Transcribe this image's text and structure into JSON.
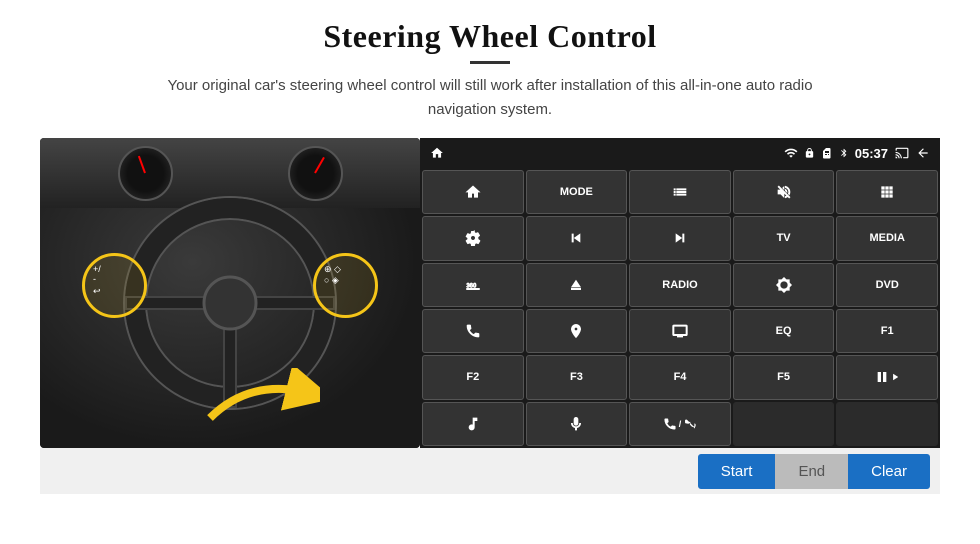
{
  "header": {
    "title": "Steering Wheel Control",
    "subtitle": "Your original car's steering wheel control will still work after installation of this all-in-one auto radio navigation system."
  },
  "statusBar": {
    "time": "05:37",
    "icons": [
      "wifi",
      "lock",
      "sim",
      "bluetooth",
      "screen",
      "back"
    ]
  },
  "controlButtons": [
    {
      "id": "row1",
      "buttons": [
        {
          "label": "",
          "icon": "home"
        },
        {
          "label": "MODE",
          "icon": ""
        },
        {
          "label": "",
          "icon": "list"
        },
        {
          "label": "",
          "icon": "mute"
        },
        {
          "label": "",
          "icon": "apps"
        }
      ]
    },
    {
      "id": "row2",
      "buttons": [
        {
          "label": "",
          "icon": "settings"
        },
        {
          "label": "",
          "icon": "rewind"
        },
        {
          "label": "",
          "icon": "forward"
        },
        {
          "label": "TV",
          "icon": ""
        },
        {
          "label": "MEDIA",
          "icon": ""
        }
      ]
    },
    {
      "id": "row3",
      "buttons": [
        {
          "label": "",
          "icon": "360"
        },
        {
          "label": "",
          "icon": "eject"
        },
        {
          "label": "RADIO",
          "icon": ""
        },
        {
          "label": "",
          "icon": "brightness"
        },
        {
          "label": "DVD",
          "icon": ""
        }
      ]
    },
    {
      "id": "row4",
      "buttons": [
        {
          "label": "",
          "icon": "phone"
        },
        {
          "label": "",
          "icon": "gps"
        },
        {
          "label": "",
          "icon": "screen2"
        },
        {
          "label": "EQ",
          "icon": ""
        },
        {
          "label": "F1",
          "icon": ""
        }
      ]
    },
    {
      "id": "row5",
      "buttons": [
        {
          "label": "F2",
          "icon": ""
        },
        {
          "label": "F3",
          "icon": ""
        },
        {
          "label": "F4",
          "icon": ""
        },
        {
          "label": "F5",
          "icon": ""
        },
        {
          "label": "",
          "icon": "playpause"
        }
      ]
    },
    {
      "id": "row6",
      "buttons": [
        {
          "label": "",
          "icon": "music"
        },
        {
          "label": "",
          "icon": "mic"
        },
        {
          "label": "",
          "icon": "voicecall"
        },
        {
          "label": "",
          "icon": ""
        },
        {
          "label": "",
          "icon": ""
        }
      ]
    }
  ],
  "actionBar": {
    "startLabel": "Start",
    "endLabel": "End",
    "clearLabel": "Clear"
  }
}
